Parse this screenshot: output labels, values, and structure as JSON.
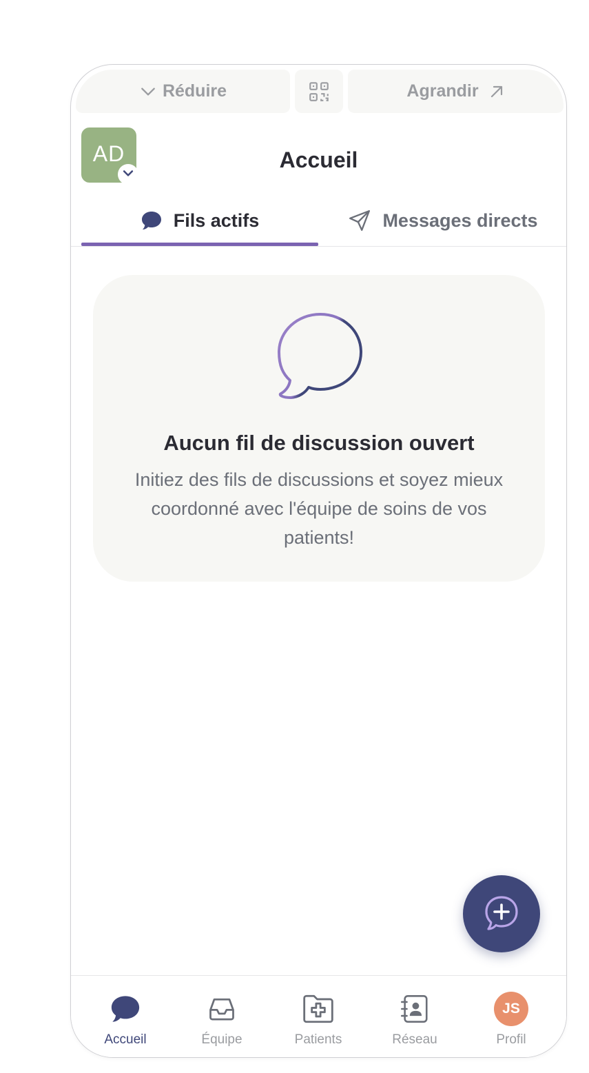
{
  "controls": {
    "reduce_label": "Réduire",
    "enlarge_label": "Agrandir"
  },
  "header": {
    "avatar_initials": "AD",
    "title": "Accueil"
  },
  "tabs": [
    {
      "label": "Fils actifs",
      "icon": "chat-bubble-icon",
      "active": true
    },
    {
      "label": "Messages directs",
      "icon": "send-icon",
      "active": false
    }
  ],
  "empty_state": {
    "title": "Aucun fil de discussion ouvert",
    "description": "Initiez des fils de discussions et soyez mieux coordonné avec l'équipe de soins de vos patients!"
  },
  "bottom_nav": [
    {
      "label": "Accueil",
      "icon": "chat-bubble-icon",
      "active": true
    },
    {
      "label": "Équipe",
      "icon": "inbox-icon",
      "active": false
    },
    {
      "label": "Patients",
      "icon": "patient-folder-icon",
      "active": false
    },
    {
      "label": "Réseau",
      "icon": "contact-book-icon",
      "active": false
    },
    {
      "label": "Profil",
      "icon": "avatar",
      "initials": "JS",
      "active": false
    }
  ],
  "colors": {
    "primary": "#3f4779",
    "accent": "#7b63b1",
    "avatar_green": "#98b383",
    "profile_orange": "#e8906c",
    "card_bg": "#f7f7f4",
    "muted_text": "#9a9ca0"
  }
}
